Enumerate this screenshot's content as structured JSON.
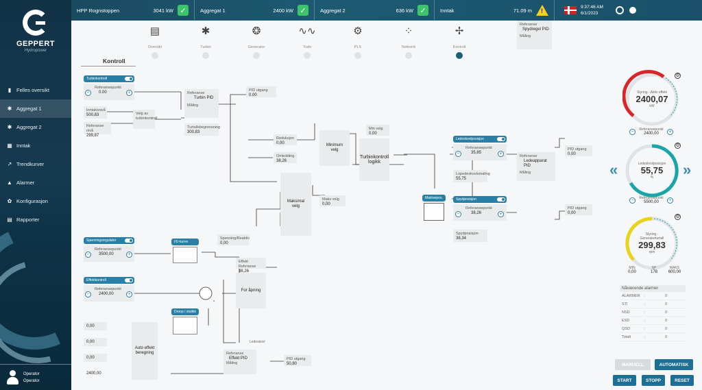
{
  "brand": {
    "name": "GEPPERT",
    "sub": "Hydropower"
  },
  "nav": [
    {
      "label": "Felles oversikt",
      "icon": "chart-icon"
    },
    {
      "label": "Aggregat 1",
      "icon": "gear-icon",
      "active": true
    },
    {
      "label": "Aggregat 2",
      "icon": "gear-icon"
    },
    {
      "label": "Inntak",
      "icon": "grid-icon"
    },
    {
      "label": "Trendkurver",
      "icon": "trend-icon"
    },
    {
      "label": "Alarmer",
      "icon": "bell-icon"
    },
    {
      "label": "Konfigurasjon",
      "icon": "gear-icon"
    },
    {
      "label": "Rapporter",
      "icon": "doc-icon"
    }
  ],
  "operator": {
    "role": "Operator",
    "name": "Operator"
  },
  "topbar": {
    "s1": {
      "label": "HPP Rognstoppen",
      "value": "3041 kW"
    },
    "s2": {
      "label": "Aggregat 1",
      "value": "2400 kW"
    },
    "s3": {
      "label": "Aggregat 2",
      "value": "636 kW"
    },
    "s4": {
      "label": "Inntak",
      "value": "71.09 m"
    },
    "time": "9:37:46 AM",
    "date": "6/1/2023"
  },
  "steps": [
    {
      "label": "Oversikt",
      "icon": "doc-icon"
    },
    {
      "label": "Turbin",
      "icon": "gear-icon"
    },
    {
      "label": "Generator",
      "icon": "fan-icon"
    },
    {
      "label": "Trafo",
      "icon": "wave-icon"
    },
    {
      "label": "PLS",
      "icon": "gear-icon"
    },
    {
      "label": "Nettverk",
      "icon": "network-icon"
    },
    {
      "label": "Kontroll",
      "icon": "control-icon",
      "active": true
    }
  ],
  "page": {
    "title": "Kontroll"
  },
  "diagram": {
    "turb": {
      "tag": "Turbinkontroll",
      "ref_label": "Referansepunkt",
      "ref": "0.00"
    },
    "nivaa": {
      "l1": "Inntaksnivå",
      "v1": "500,83",
      "l2": "Referanse nivå",
      "v2": "299,87"
    },
    "velg": {
      "label": "Velg av turbinkontroll"
    },
    "pid1": {
      "l1": "Referanse",
      "name": "Turbin PID",
      "l2": "Måling",
      "l3": "Turtallsbegrensning",
      "v3": "300,83"
    },
    "pid1out": {
      "label": "PID utgang",
      "value": "0.00"
    },
    "omk": {
      "l1": "Reduksjon",
      "v1": "0,00",
      "l2": "Omkobling",
      "v2": "38,26"
    },
    "minv": {
      "label": "Minimum velg"
    },
    "maxv": {
      "label": "Maksimal velg"
    },
    "maxmin": {
      "label": "Maks velg",
      "value": "0,00"
    },
    "minmax": {
      "label": "Min velg",
      "value": "0,00"
    },
    "tmodel": {
      "label": "Turbinkontroll logikk"
    },
    "ledel": {
      "tag": "Ledeskovlposisjon",
      "ref_label": "Referansepunkt",
      "ref": "35,85",
      "l2": "Lopedeskovlsmaling",
      "v2": "55,75"
    },
    "lpid": {
      "l1": "Referanse",
      "name": "Ledeapparat PID",
      "l2": "Måling"
    },
    "lout": {
      "label": "PID utgang",
      "value": "0,00"
    },
    "matrix": {
      "label": "Matrisepos."
    },
    "spear": {
      "tag": "Spydposisjon",
      "ref_label": "Referansepunkt",
      "ref": "38,26",
      "l2": "Spydposisjon",
      "v2": "38,34"
    },
    "spid": {
      "l1": "Referanse",
      "name": "Spydregel PID",
      "l2": "Måling"
    },
    "sout": {
      "label": "PID utgang",
      "value": "0,00"
    },
    "sp": {
      "tag": "Spenningsregulator",
      "ref_label": "Referansepunkt",
      "ref": "3500,00"
    },
    "ucl": {
      "tag": "I/U-kurve"
    },
    "spout": {
      "label": "Spenning/Reaktiv",
      "value": "0,00"
    },
    "eff": {
      "tag": "Effektkontroll",
      "ref_label": "Referansepunkt",
      "ref": "2400,00"
    },
    "drop": {
      "tag": "Droop / statikk"
    },
    "effref": {
      "label": "Effekt Referanse",
      "value": "38,26"
    },
    "forap": {
      "label": "For åpning"
    },
    "epid": {
      "l1": "Referanse",
      "name": "Effekt PID",
      "l2": "Måling",
      "lim": "Ledeskovl"
    },
    "eout": {
      "label": "PID utgang",
      "value": "50,80"
    },
    "inputs": [
      "0,00",
      "0,00",
      "0,00",
      "2400,00"
    ],
    "auto": {
      "label": "Auto effekt beregning"
    }
  },
  "right": {
    "g1": {
      "t1": "Styring - Aktiv effekt",
      "value": "2400,07",
      "unit": "kW",
      "ref_label": "Referansepunkt",
      "ref": "2400,00",
      "color": "#d9262a"
    },
    "g2": {
      "t1": "Ledeskovlposisjon",
      "value": "55,75",
      "unit": "%",
      "ref_label": "Referansepunkt",
      "ref": "5500,00",
      "color": "#1aa6a8"
    },
    "g3": {
      "t1": "Styring - Generatorturtall",
      "value": "299,83",
      "unit": "rpm",
      "color": "#e8d21a",
      "m1l": "MIN",
      "m1": "0,00",
      "m2l": "SP",
      "m2": "178",
      "m3l": "MAKS",
      "m3": "600,00"
    },
    "alarms": {
      "title": "Nåværende alarmer",
      "rows": [
        {
          "n": "ALARMER",
          "v": "0"
        },
        {
          "n": "STI",
          "v": "0"
        },
        {
          "n": "NSD",
          "v": "0"
        },
        {
          "n": "ESD",
          "v": "0"
        },
        {
          "n": "QSD",
          "v": "0"
        },
        {
          "n": "Totalt",
          "v": "0"
        }
      ]
    },
    "buttons": {
      "manual": "MANUELL",
      "auto": "AUTOMATISK",
      "start": "START",
      "stop": "STOPP",
      "reset": "RESET"
    }
  }
}
